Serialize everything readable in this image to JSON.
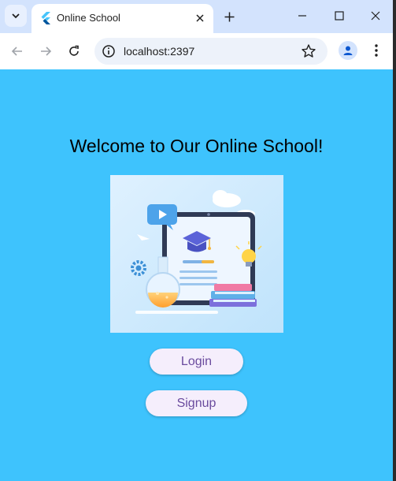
{
  "browser": {
    "tab": {
      "title": "Online School",
      "favicon": "flutter-logo-icon"
    },
    "address_bar": {
      "url": "localhost:2397"
    },
    "icons": {
      "tab_search": "chevron-down-icon",
      "close_tab": "close-icon",
      "new_tab": "plus-icon",
      "minimize": "minimize-icon",
      "maximize": "maximize-icon",
      "close_window": "close-icon",
      "back": "arrow-left-icon",
      "forward": "arrow-right-icon",
      "reload": "reload-icon",
      "site_info": "info-icon",
      "bookmark": "star-icon",
      "profile": "person-icon",
      "menu": "kebab-menu-icon"
    }
  },
  "page": {
    "heading": "Welcome to Our Online School!",
    "login_label": "Login",
    "signup_label": "Signup"
  },
  "colors": {
    "page_background": "#3ec3fd",
    "button_background": "#f5eefc",
    "button_text": "#6a4b9e",
    "chrome_frame": "#d3e3fd"
  }
}
